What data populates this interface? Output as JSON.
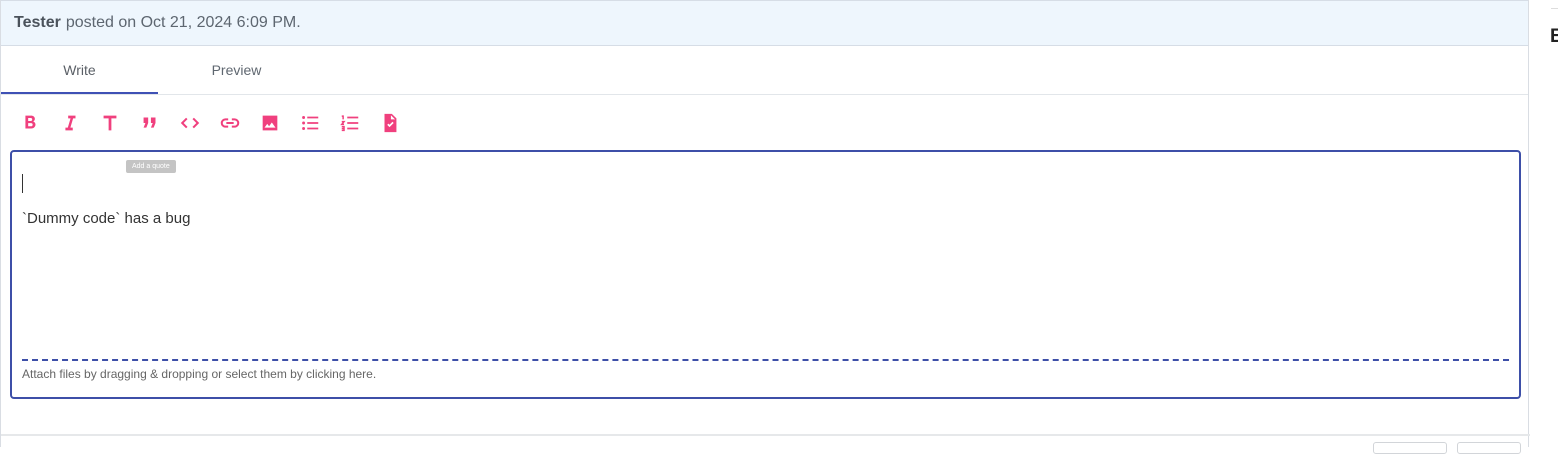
{
  "post": {
    "author": "Tester",
    "meta": "posted on Oct 21, 2024 6:09 PM."
  },
  "tabs": [
    {
      "label": "Write",
      "active": true
    },
    {
      "label": "Preview",
      "active": false
    }
  ],
  "toolbar": {
    "icons": [
      "bold-icon",
      "italic-icon",
      "heading-icon",
      "quote-icon",
      "code-icon",
      "link-icon",
      "image-icon",
      "bulleted-list-icon",
      "numbered-list-icon",
      "task-list-icon"
    ],
    "tooltip": "Add a quote",
    "accent": "#f0407e"
  },
  "editor": {
    "content": "`Dummy code` has a bug",
    "attach_hint": "Attach files by dragging & dropping or select them by clicking here.",
    "border_color": "#3d4fa8"
  },
  "side": {
    "letter": "E"
  }
}
